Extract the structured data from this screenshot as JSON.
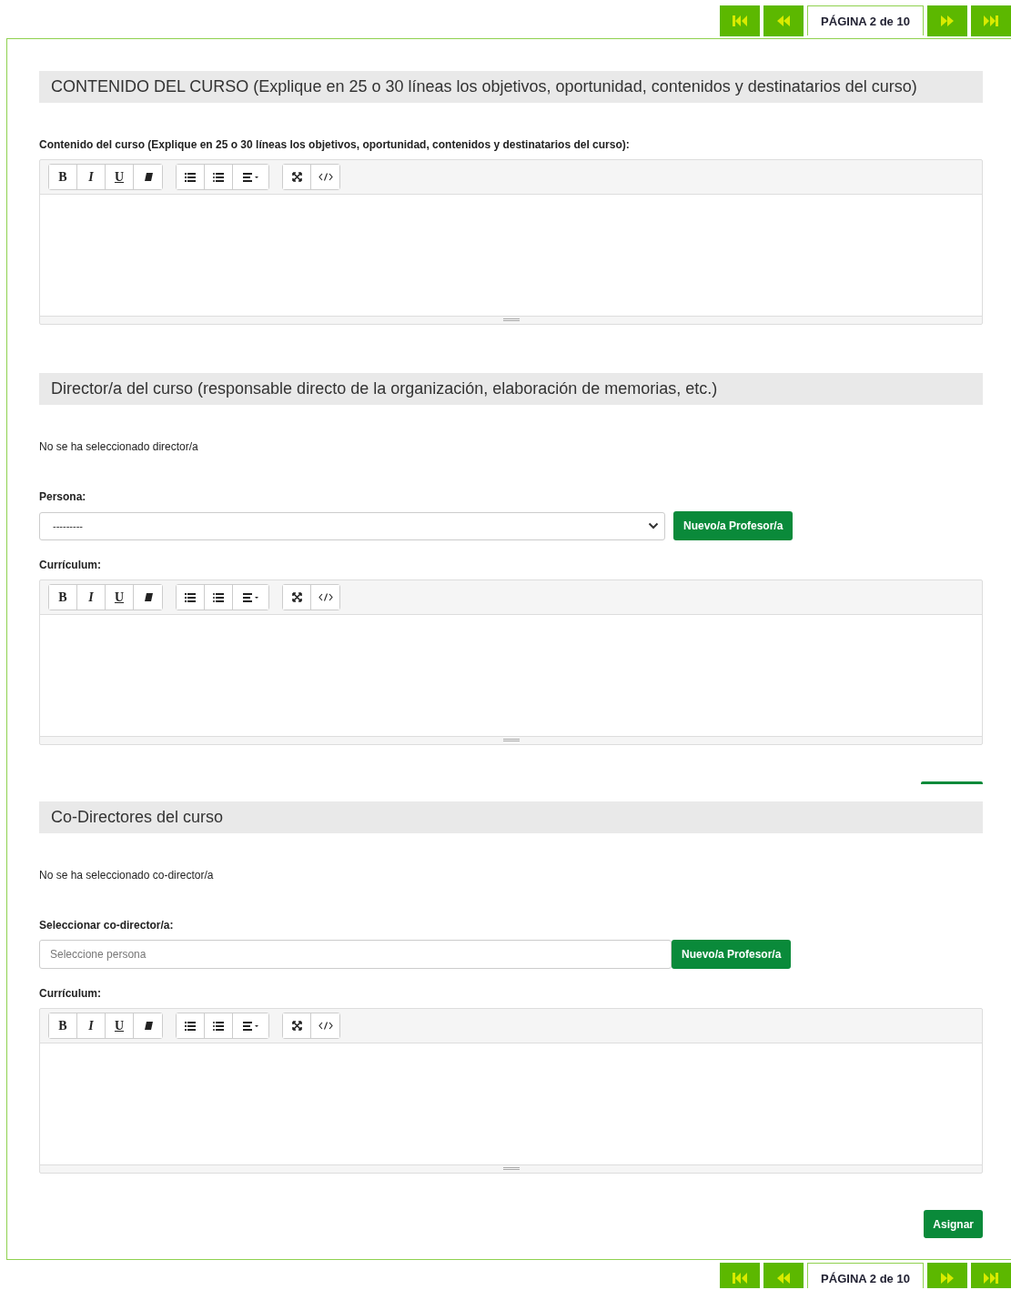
{
  "pager_top": {
    "label": "PÁGINA 2 de 10"
  },
  "sections": [
    {
      "kind": "content",
      "heading": "CONTENIDO DEL CURSO (Explique en 25 o 30 líneas los objetivos, oportunidad, contenidos y destinatarios del curso)",
      "field_label": "Contenido del curso (Explique en 25 o 30 líneas los objetivos, oportunidad, contenidos y destinatarios del curso):",
      "format_buttons": [
        "B",
        "I",
        "U"
      ]
    },
    {
      "kind": "select",
      "heading": "Director/a del curso (responsable directo de la organización, elaboración de memorias, etc.)",
      "status": "No se ha seleccionado director/a",
      "select_label": "Persona:",
      "select_value": "---------",
      "new_button": "Nuevo/a Profesor/a",
      "field_label": "Currículum:",
      "format_buttons": [
        "B",
        "I",
        "U"
      ]
    },
    {
      "kind": "search",
      "heading": "Co-Directores del curso",
      "status": "No se ha seleccionado co-director/a",
      "select_label": "Seleccionar co-director/a:",
      "placeholder": "Seleccione persona",
      "new_button": "Nuevo/a Profesor/a",
      "field_label": "Currículum:",
      "format_buttons": [
        "B",
        "I",
        "U"
      ],
      "submit_button": "Asignar"
    }
  ],
  "pager_bottom": {
    "label": "PÁGINA 2 de 10"
  }
}
